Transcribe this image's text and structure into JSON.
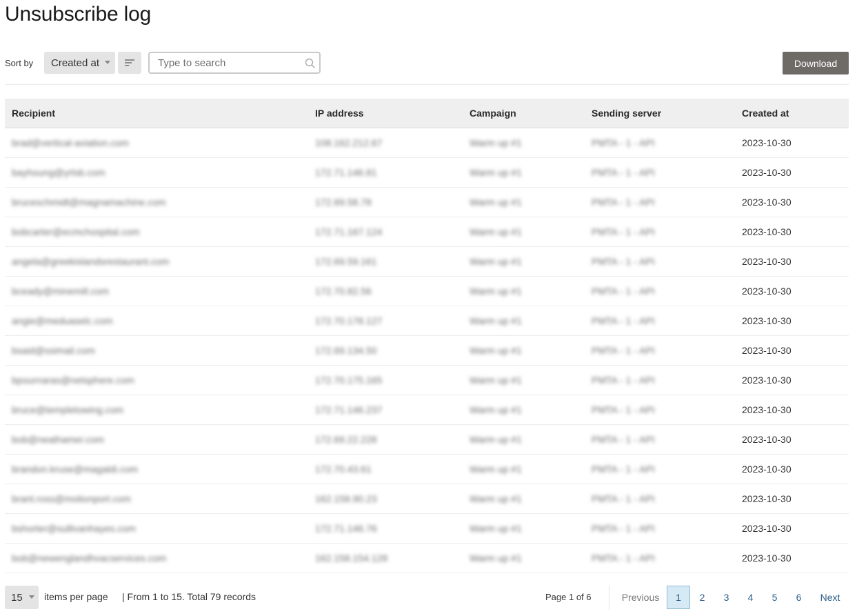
{
  "page": {
    "title": "Unsubscribe log"
  },
  "toolbar": {
    "sort_label": "Sort by",
    "sort_value": "Created at",
    "search_placeholder": "Type to search",
    "download_label": "Download"
  },
  "table": {
    "columns": [
      "Recipient",
      "IP address",
      "Campaign",
      "Sending server",
      "Created at"
    ],
    "rows": [
      {
        "recipient": "brad@vertical-aviation.com",
        "ip": "108.162.212.67",
        "campaign": "Warm up #1",
        "server": "PMTA - 1 - API",
        "created": "2023-10-30"
      },
      {
        "recipient": "bayhoung@yrlsb.com",
        "ip": "172.71.146.81",
        "campaign": "Warm up #1",
        "server": "PMTA - 1 - API",
        "created": "2023-10-30"
      },
      {
        "recipient": "bruceschmidt@magnamachine.com",
        "ip": "172.69.58.78",
        "campaign": "Warm up #1",
        "server": "PMTA - 1 - API",
        "created": "2023-10-30"
      },
      {
        "recipient": "bobcarter@ecmchospital.com",
        "ip": "172.71.167.124",
        "campaign": "Warm up #1",
        "server": "PMTA - 1 - API",
        "created": "2023-10-30"
      },
      {
        "recipient": "angela@greekislandsrestaurant.com",
        "ip": "172.69.59.161",
        "campaign": "Warm up #1",
        "server": "PMTA - 1 - API",
        "created": "2023-10-30"
      },
      {
        "recipient": "bceady@minemill.com",
        "ip": "172.70.82.56",
        "campaign": "Warm up #1",
        "server": "PMTA - 1 - API",
        "created": "2023-10-30"
      },
      {
        "recipient": "angie@meduaselc.com",
        "ip": "172.70.178.127",
        "campaign": "Warm up #1",
        "server": "PMTA - 1 - API",
        "created": "2023-10-30"
      },
      {
        "recipient": "bsaid@ssimail.com",
        "ip": "172.69.134.50",
        "campaign": "Warm up #1",
        "server": "PMTA - 1 - API",
        "created": "2023-10-30"
      },
      {
        "recipient": "bpournaras@netsphere.com",
        "ip": "172.70.175.165",
        "campaign": "Warm up #1",
        "server": "PMTA - 1 - API",
        "created": "2023-10-30"
      },
      {
        "recipient": "bruce@templetowing.com",
        "ip": "172.71.146.237",
        "campaign": "Warm up #1",
        "server": "PMTA - 1 - API",
        "created": "2023-10-30"
      },
      {
        "recipient": "bob@neathamer.com",
        "ip": "172.69.22.228",
        "campaign": "Warm up #1",
        "server": "PMTA - 1 - API",
        "created": "2023-10-30"
      },
      {
        "recipient": "brandon.kruse@magaldi.com",
        "ip": "172.70.43.61",
        "campaign": "Warm up #1",
        "server": "PMTA - 1 - API",
        "created": "2023-10-30"
      },
      {
        "recipient": "brant.ross@motionport.com",
        "ip": "162.158.90.23",
        "campaign": "Warm up #1",
        "server": "PMTA - 1 - API",
        "created": "2023-10-30"
      },
      {
        "recipient": "bshorter@sullivanhayes.com",
        "ip": "172.71.146.76",
        "campaign": "Warm up #1",
        "server": "PMTA - 1 - API",
        "created": "2023-10-30"
      },
      {
        "recipient": "bob@newenglandhvacservices.com",
        "ip": "162.158.154.128",
        "campaign": "Warm up #1",
        "server": "PMTA - 1 - API",
        "created": "2023-10-30"
      }
    ]
  },
  "footer": {
    "per_page_value": "15",
    "per_page_label": "items per page",
    "records_summary": "| From 1 to 15. Total 79 records",
    "page_info": "Page 1 of 6",
    "previous_label": "Previous",
    "next_label": "Next",
    "pages": [
      "1",
      "2",
      "3",
      "4",
      "5",
      "6"
    ],
    "current_page": "1"
  },
  "colors": {
    "download_button": "#6e6a66",
    "header_background": "#efefef",
    "active_page": "#d6eaf6",
    "link": "#2e5f8a"
  }
}
